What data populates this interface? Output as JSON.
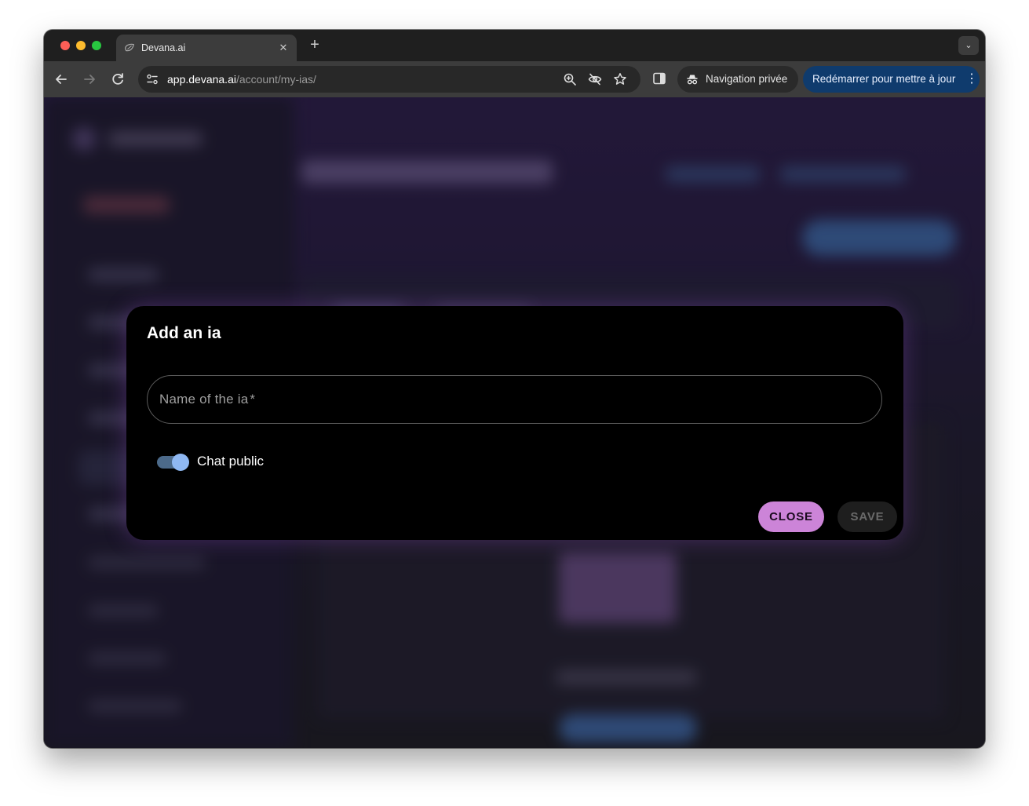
{
  "browser": {
    "tab": {
      "title": "Devana.ai",
      "close_glyph": "✕"
    },
    "new_tab_glyph": "+",
    "tab_search_glyph": "⌄",
    "address": {
      "host": "app.devana.ai",
      "path": "/account/my-ias/"
    },
    "incognito_label": "Navigation privée",
    "update_label": "Redémarrer pour mettre à jour",
    "update_menu_glyph": "⋮",
    "icons": [
      "back-icon",
      "forward-icon",
      "reload-icon",
      "site-settings-icon",
      "zoom-icon",
      "eye-off-icon",
      "star-icon",
      "side-panel-icon",
      "incognito-icon"
    ]
  },
  "dialog": {
    "title": "Add an ia",
    "name_field": {
      "label": "Name of the ia",
      "required_mark": "*",
      "value": ""
    },
    "toggle": {
      "label": "Chat public",
      "checked": true
    },
    "buttons": {
      "close": "CLOSE",
      "save": "SAVE"
    }
  },
  "colors": {
    "accent_close": "#cc84d8",
    "toggle_thumb": "#8fb8f2",
    "update_pill": "#0f3b6d"
  }
}
